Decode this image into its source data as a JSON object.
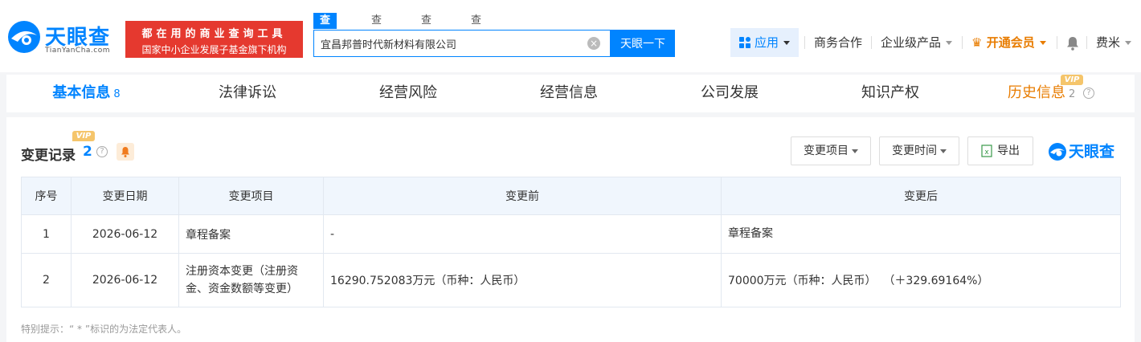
{
  "header": {
    "logo_text": "天眼查",
    "logo_domain": "TianYanCha.com",
    "slogan_line1": "都在用的商业查询工具",
    "slogan_line2": "国家中小企业发展子基金旗下机构",
    "search_tabs": [
      "查公司",
      "查老板",
      "查关系",
      "查风险"
    ],
    "search_value": "宜昌邦普时代新材料有限公司",
    "search_button": "天眼一下",
    "nav": {
      "apps": "应用",
      "business": "商务合作",
      "enterprise": "企业级产品",
      "vip": "开通会员",
      "user": "费米"
    }
  },
  "tabs": [
    {
      "label": "基本信息",
      "count": "8"
    },
    {
      "label": "法律诉讼"
    },
    {
      "label": "经营风险"
    },
    {
      "label": "经营信息"
    },
    {
      "label": "公司发展"
    },
    {
      "label": "知识产权"
    },
    {
      "label": "历史信息",
      "count": "2",
      "badge": "VIP"
    }
  ],
  "section": {
    "title": "变更记录",
    "count": "2",
    "badge": "VIP",
    "filter_item": "变更项目",
    "filter_time": "变更时间",
    "export": "导出",
    "brand": "天眼查"
  },
  "table": {
    "headers": [
      "序号",
      "变更日期",
      "变更项目",
      "变更前",
      "变更后"
    ],
    "rows": [
      {
        "no": "1",
        "date": "2026-06-12",
        "item": "章程备案",
        "before": "-",
        "after": "章程备案"
      },
      {
        "no": "2",
        "date": "2026-06-12",
        "item": "注册资本变更（注册资金、资金数额等变更）",
        "before": "16290.752083万元（币种：人民币）",
        "after": "70000万元（币种：人民币）  （＋329.69164%）"
      }
    ]
  },
  "note": "特别提示：“ * ”标识的为法定代表人。",
  "colors": {
    "brand_blue": "#0084ff",
    "slogan_red": "#e5392f",
    "vip_orange": "#e87c00",
    "after_red": "#e5523a"
  }
}
